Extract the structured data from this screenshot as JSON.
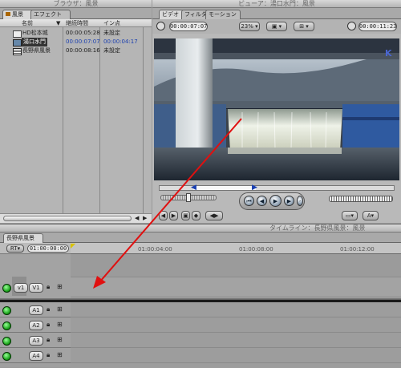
{
  "browser": {
    "title": "ブラウザ：風景",
    "tabs": [
      "風景",
      "エフェクト"
    ],
    "columns": [
      "名前",
      "継続時間",
      "イン点"
    ],
    "items": [
      {
        "name": "HD松本城",
        "duration": "00:00:05:28",
        "in": "未設定",
        "icon": "clip-icon"
      },
      {
        "name": "湯口水門",
        "duration": "00:00:07:07",
        "in": "00:00:04:17",
        "icon": "clip-icon"
      },
      {
        "name": "長野県風景",
        "duration": "00:00:08:16",
        "in": "未設定",
        "icon": "sequence-icon"
      }
    ]
  },
  "viewer": {
    "title": "ビューア：湯口水門：風景",
    "tabs": [
      "ビデオ",
      "フィルタ",
      "モーション"
    ],
    "timecode_duration": "00:00:07:07",
    "zoom": "23%",
    "timecode_current": "00:00:11:23"
  },
  "timeline": {
    "title": "タイムライン：長野県風景：風景",
    "sequence_tab": "長野県風景",
    "rt_label": "RT",
    "current_time": "01:00:00:00",
    "ruler_labels": [
      "01:00:04:00",
      "01:00:08:00",
      "01:00:12:00"
    ],
    "video_tracks": [
      {
        "source": "v1",
        "dest": "V1"
      }
    ],
    "audio_tracks": [
      "A1",
      "A2",
      "A3",
      "A4"
    ]
  },
  "colors": {
    "annotation_arrow": "#e01010",
    "accent_blue": "#1a3fb0"
  }
}
